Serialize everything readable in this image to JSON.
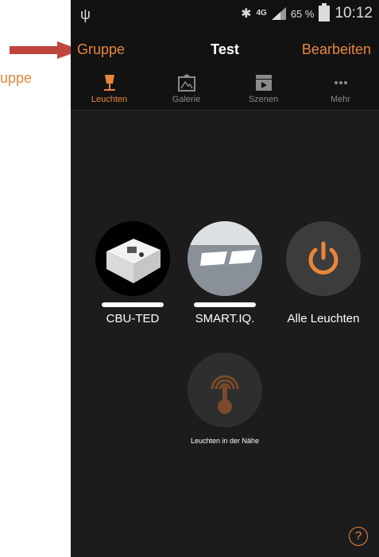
{
  "annotation": {
    "label": "uppe"
  },
  "statusbar": {
    "usb_icon": "usb-icon",
    "bluetooth_icon": "bluetooth-icon",
    "network": "4G",
    "battery_percent": "65 %",
    "time": "10:12"
  },
  "navbar": {
    "back_label": "Gruppe",
    "title": "Test",
    "edit_label": "Bearbeiten"
  },
  "tabs": [
    {
      "label": "Leuchten",
      "icon": "lamp-icon",
      "active": true
    },
    {
      "label": "Galerie",
      "icon": "gallery-icon",
      "active": false
    },
    {
      "label": "Szenen",
      "icon": "scenes-icon",
      "active": false
    },
    {
      "label": "Mehr",
      "icon": "more-icon",
      "active": false
    }
  ],
  "devices": [
    {
      "label": "CBU-TED"
    },
    {
      "label": "SMART.IQ."
    },
    {
      "label": "Alle Leuchten"
    }
  ],
  "nearby": {
    "label": "Leuchten in der Nähe"
  },
  "help": {
    "label": "?"
  },
  "colors": {
    "accent": "#e9863b",
    "background": "#1c1c1c",
    "bar": "#121212"
  }
}
